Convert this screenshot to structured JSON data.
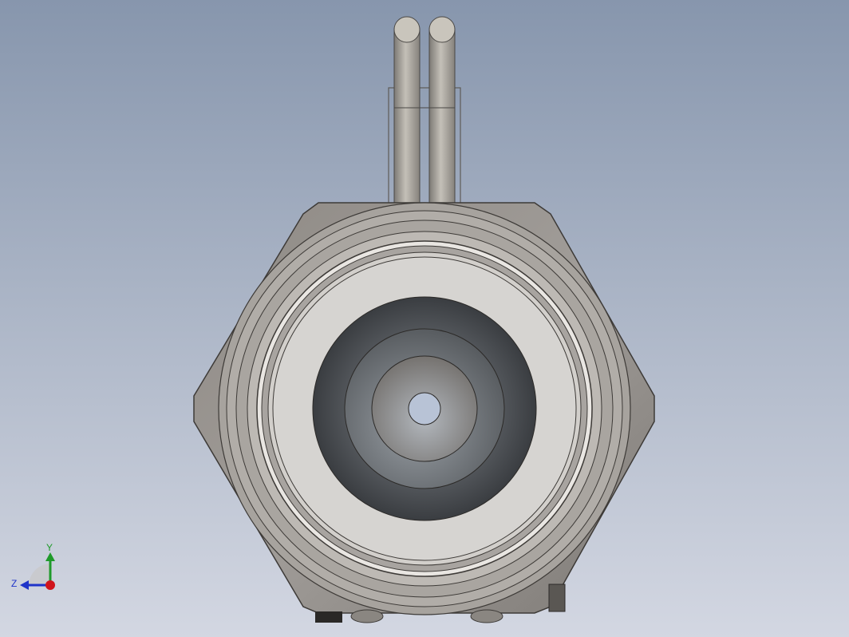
{
  "viewport": {
    "background_top": "#8796ad",
    "background_bottom": "#d3d7e2",
    "model_color": "#9a9692"
  },
  "triad": {
    "y_label": "Y",
    "z_label": "Z",
    "y_color": "#1f9a2a",
    "z_color": "#1f34c9",
    "x_color": "#d0141c"
  }
}
